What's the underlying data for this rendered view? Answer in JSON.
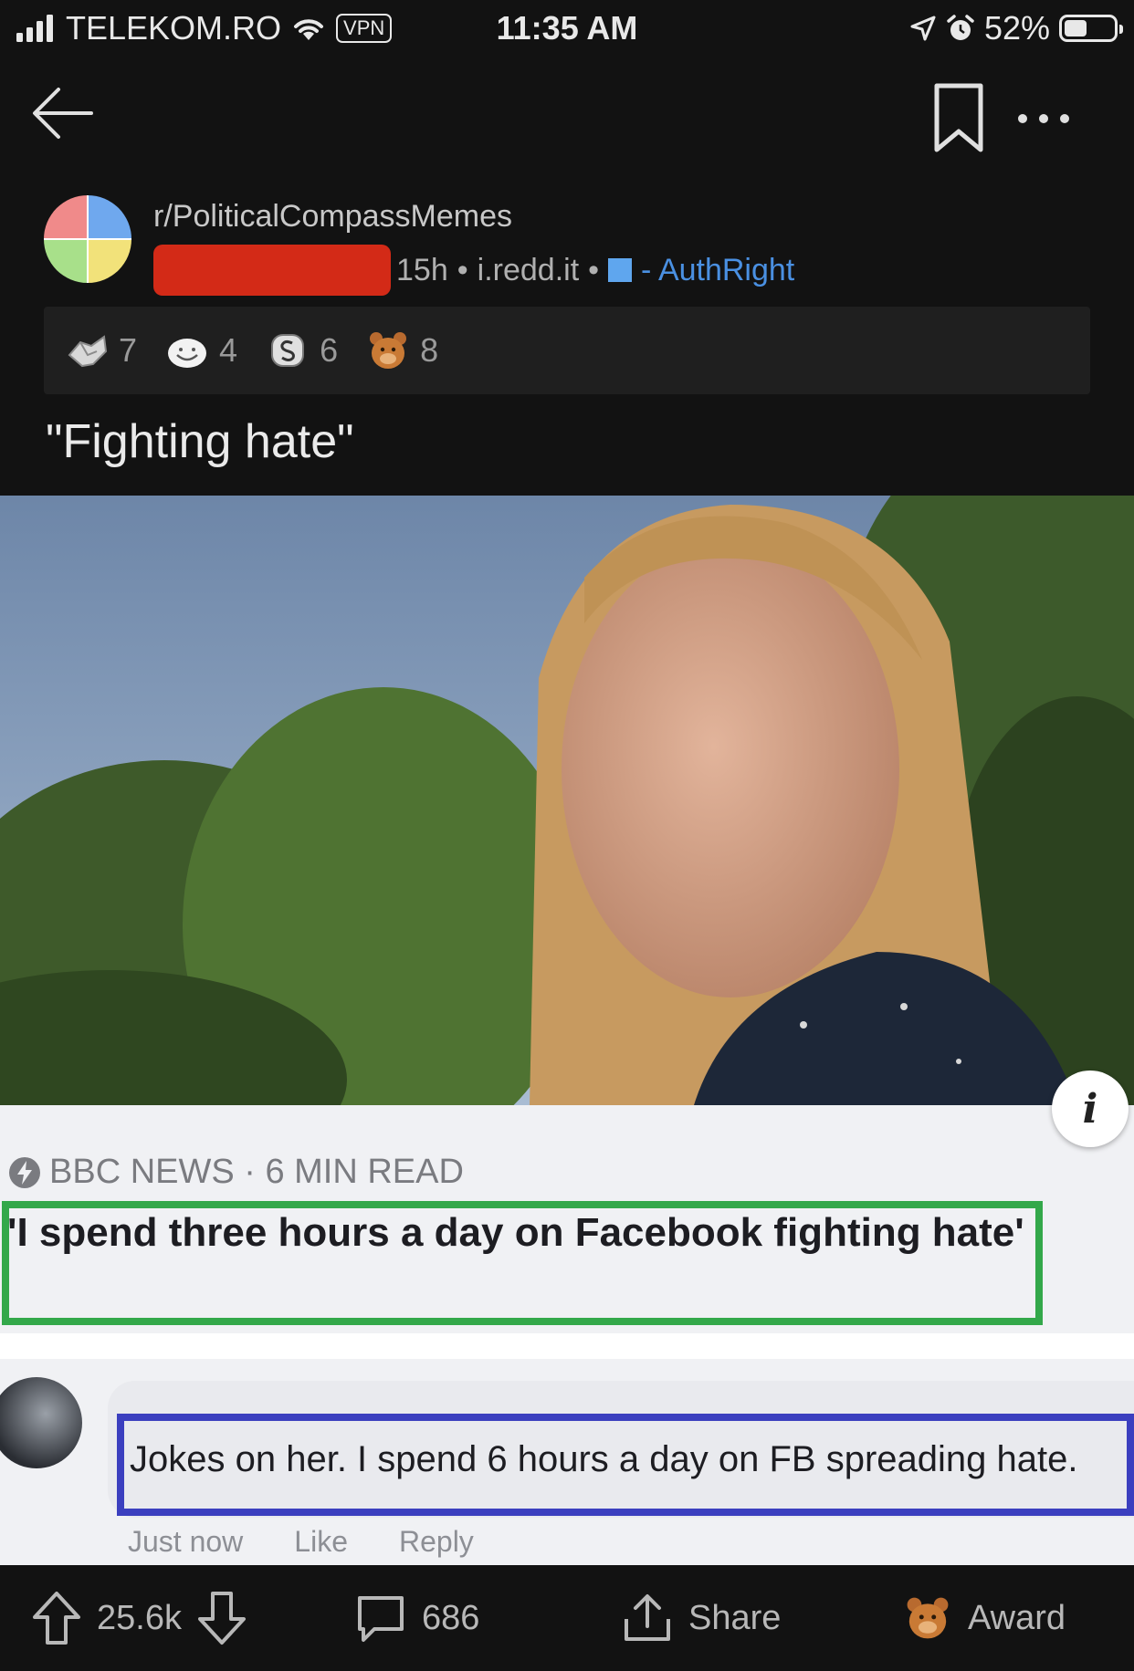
{
  "status_bar": {
    "carrier": "TELEKOM.RO",
    "vpn": "VPN",
    "time": "11:35 AM",
    "battery_percent": "52%",
    "battery_level": 0.52
  },
  "nav": {
    "icons": [
      "back-arrow-icon",
      "bookmark-icon",
      "more-icon"
    ]
  },
  "post": {
    "subreddit": "r/PoliticalCompassMemes",
    "age": "15h",
    "domain": "i.redd.it",
    "flair": "- AuthRight",
    "flair_color": "#4a90e2",
    "title": "\"Fighting hate\"",
    "awards": [
      {
        "icon": "handshake-award-icon",
        "count": "7"
      },
      {
        "icon": "smile-award-icon",
        "count": "4"
      },
      {
        "icon": "coin-award-icon",
        "count": "6"
      },
      {
        "icon": "bear-award-icon",
        "count": "8"
      }
    ]
  },
  "image": {
    "source_line": "BBC NEWS · 6 MIN READ",
    "headline": "'I spend three hours a day on Facebook fighting hate'",
    "comment": "Jokes on her. I spend 6 hours a day on FB spreading hate.",
    "comment_actions": [
      "Just now",
      "Like",
      "Reply"
    ],
    "info_badge": "i",
    "headline_box_color": "#33a84a",
    "comment_box_color": "#3b3fbf"
  },
  "actions": {
    "upvotes": "25.6k",
    "comments": "686",
    "share": "Share",
    "award": "Award"
  }
}
